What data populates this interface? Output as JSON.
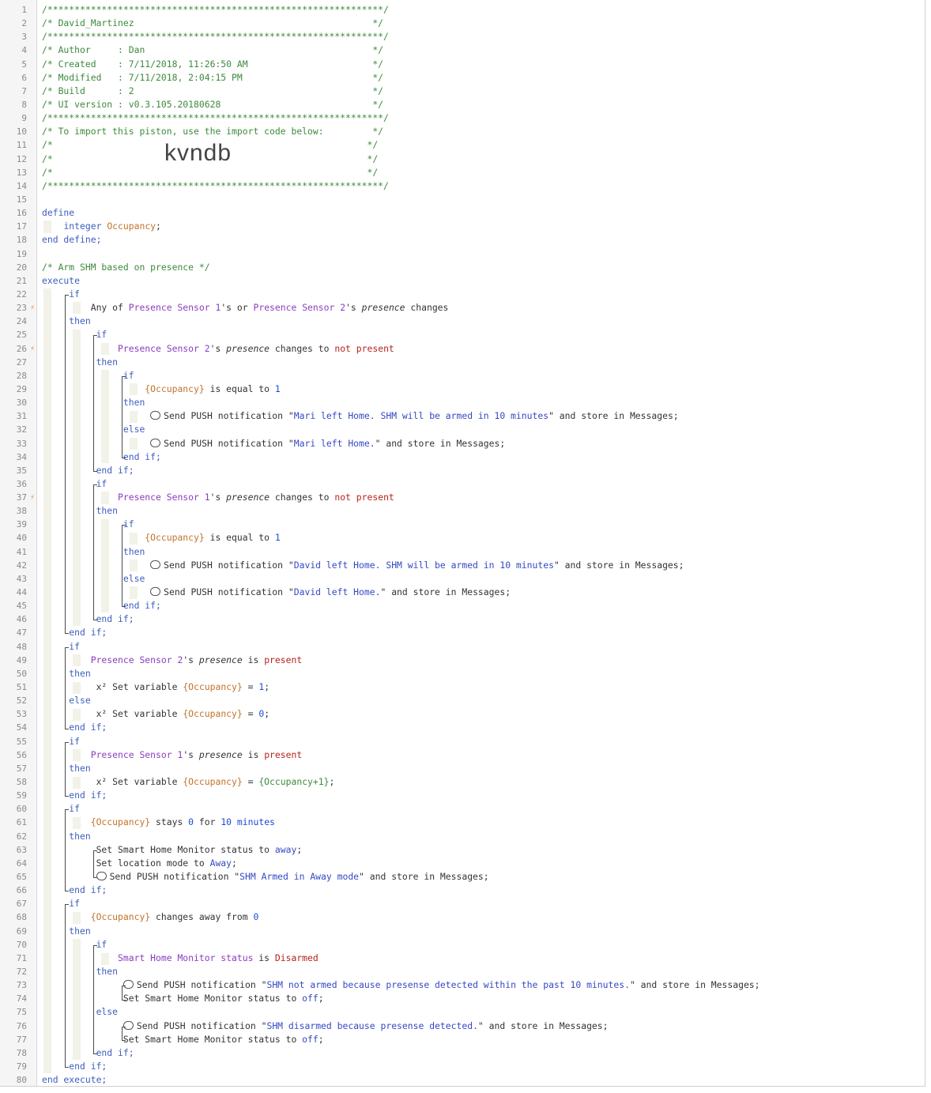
{
  "import_code": "kvndb",
  "lines": [
    {
      "n": 1,
      "t": "/**************************************************************/",
      "cls": "c-comment"
    },
    {
      "n": 2,
      "t": "/* David_Martinez                                            */",
      "cls": "c-comment"
    },
    {
      "n": 3,
      "t": "/**************************************************************/",
      "cls": "c-comment"
    },
    {
      "n": 4,
      "t": "/* Author     : Dan                                          */",
      "cls": "c-comment"
    },
    {
      "n": 5,
      "t": "/* Created    : 7/11/2018, 11:26:50 AM                       */",
      "cls": "c-comment"
    },
    {
      "n": 6,
      "t": "/* Modified   : 7/11/2018, 2:04:15 PM                        */",
      "cls": "c-comment"
    },
    {
      "n": 7,
      "t": "/* Build      : 2                                            */",
      "cls": "c-comment"
    },
    {
      "n": 8,
      "t": "/* UI version : v0.3.105.20180628                            */",
      "cls": "c-comment"
    },
    {
      "n": 9,
      "t": "/**************************************************************/",
      "cls": "c-comment"
    },
    {
      "n": 10,
      "t": "/* To import this piston, use the import code below:         */",
      "cls": "c-comment"
    },
    {
      "n": 11,
      "t": "/*                                                          */",
      "cls": "c-comment"
    },
    {
      "n": 12,
      "t": "/*                                                          */",
      "cls": "c-comment",
      "import": true
    },
    {
      "n": 13,
      "t": "/*                                                          */",
      "cls": "c-comment"
    },
    {
      "n": 14,
      "t": "/**************************************************************/",
      "cls": "c-comment"
    },
    {
      "n": 15,
      "t": "",
      "cls": "c-plain"
    },
    {
      "n": 16,
      "t": "define",
      "cls": "c-kw"
    },
    {
      "n": 17,
      "t": "",
      "segs": [
        [
          "    ",
          "c-plain"
        ],
        [
          "integer ",
          "c-kw"
        ],
        [
          "Occupancy",
          "c-var"
        ],
        [
          ";",
          "c-plain"
        ]
      ]
    },
    {
      "n": 18,
      "t": "end define;",
      "cls": "c-kw"
    },
    {
      "n": 19,
      "t": "",
      "cls": "c-plain"
    },
    {
      "n": 20,
      "t": "/* Arm SHM based on presence */",
      "cls": "c-comment"
    },
    {
      "n": 21,
      "t": "execute",
      "cls": "c-kw"
    },
    {
      "n": 22,
      "segs": [
        [
          "     if",
          "c-kw"
        ]
      ]
    },
    {
      "n": 23,
      "bolt": true,
      "segs": [
        [
          "         Any of ",
          "c-plain"
        ],
        [
          "Presence Sensor 1",
          "c-dev"
        ],
        [
          "'s or ",
          "c-plain"
        ],
        [
          "Presence Sensor 2",
          "c-dev"
        ],
        [
          "'s ",
          "c-plain"
        ],
        [
          "presence",
          "c-it"
        ],
        [
          " changes",
          "c-plain"
        ]
      ]
    },
    {
      "n": 24,
      "segs": [
        [
          "     then",
          "c-kw"
        ]
      ]
    },
    {
      "n": 25,
      "segs": [
        [
          "          if",
          "c-kw"
        ]
      ]
    },
    {
      "n": 26,
      "bolt": true,
      "segs": [
        [
          "              Presence Sensor 2",
          "c-dev"
        ],
        [
          "'s ",
          "c-plain"
        ],
        [
          "presence",
          "c-it"
        ],
        [
          " changes to ",
          "c-plain"
        ],
        [
          "not present",
          "c-red"
        ]
      ]
    },
    {
      "n": 27,
      "segs": [
        [
          "          then",
          "c-kw"
        ]
      ]
    },
    {
      "n": 28,
      "segs": [
        [
          "               if",
          "c-kw"
        ]
      ]
    },
    {
      "n": 29,
      "segs": [
        [
          "                   {Occupancy}",
          "c-var"
        ],
        [
          " is equal to ",
          "c-plain"
        ],
        [
          "1",
          "c-num"
        ]
      ]
    },
    {
      "n": 30,
      "segs": [
        [
          "               then",
          "c-kw"
        ]
      ]
    },
    {
      "n": 31,
      "bubble": true,
      "segs": [
        [
          "Send PUSH notification \"",
          "c-plain"
        ],
        [
          "Mari left Home. SHM will be armed in 10 minutes",
          "c-str"
        ],
        [
          "\" and store in Messages;",
          "c-plain"
        ]
      ],
      "indent": "                    "
    },
    {
      "n": 32,
      "segs": [
        [
          "               else",
          "c-kw"
        ]
      ]
    },
    {
      "n": 33,
      "bubble": true,
      "segs": [
        [
          "Send PUSH notification \"",
          "c-plain"
        ],
        [
          "Mari left Home.",
          "c-str"
        ],
        [
          "\" and store in Messages;",
          "c-plain"
        ]
      ],
      "indent": "                    "
    },
    {
      "n": 34,
      "segs": [
        [
          "               end if;",
          "c-kw"
        ]
      ]
    },
    {
      "n": 35,
      "segs": [
        [
          "          end if;",
          "c-kw"
        ]
      ]
    },
    {
      "n": 36,
      "segs": [
        [
          "          if",
          "c-kw"
        ]
      ]
    },
    {
      "n": 37,
      "bolt": true,
      "segs": [
        [
          "              Presence Sensor 1",
          "c-dev"
        ],
        [
          "'s ",
          "c-plain"
        ],
        [
          "presence",
          "c-it"
        ],
        [
          " changes to ",
          "c-plain"
        ],
        [
          "not present",
          "c-red"
        ]
      ]
    },
    {
      "n": 38,
      "segs": [
        [
          "          then",
          "c-kw"
        ]
      ]
    },
    {
      "n": 39,
      "segs": [
        [
          "               if",
          "c-kw"
        ]
      ]
    },
    {
      "n": 40,
      "segs": [
        [
          "                   {Occupancy}",
          "c-var"
        ],
        [
          " is equal to ",
          "c-plain"
        ],
        [
          "1",
          "c-num"
        ]
      ]
    },
    {
      "n": 41,
      "segs": [
        [
          "               then",
          "c-kw"
        ]
      ]
    },
    {
      "n": 42,
      "bubble": true,
      "segs": [
        [
          "Send PUSH notification \"",
          "c-plain"
        ],
        [
          "David left Home. SHM will be armed in 10 minutes",
          "c-str"
        ],
        [
          "\" and store in Messages;",
          "c-plain"
        ]
      ],
      "indent": "                    "
    },
    {
      "n": 43,
      "segs": [
        [
          "               else",
          "c-kw"
        ]
      ]
    },
    {
      "n": 44,
      "bubble": true,
      "segs": [
        [
          "Send PUSH notification \"",
          "c-plain"
        ],
        [
          "David left Home.",
          "c-str"
        ],
        [
          "\" and store in Messages;",
          "c-plain"
        ]
      ],
      "indent": "                    "
    },
    {
      "n": 45,
      "segs": [
        [
          "               end if;",
          "c-kw"
        ]
      ]
    },
    {
      "n": 46,
      "segs": [
        [
          "          end if;",
          "c-kw"
        ]
      ]
    },
    {
      "n": 47,
      "segs": [
        [
          "     end if;",
          "c-kw"
        ]
      ]
    },
    {
      "n": 48,
      "segs": [
        [
          "     if",
          "c-kw"
        ]
      ]
    },
    {
      "n": 49,
      "segs": [
        [
          "         Presence Sensor 2",
          "c-dev"
        ],
        [
          "'s ",
          "c-plain"
        ],
        [
          "presence",
          "c-it"
        ],
        [
          " is ",
          "c-plain"
        ],
        [
          "present",
          "c-red"
        ]
      ]
    },
    {
      "n": 50,
      "segs": [
        [
          "     then",
          "c-kw"
        ]
      ]
    },
    {
      "n": 51,
      "segs": [
        [
          "          x² Set variable ",
          "c-plain"
        ],
        [
          "{Occupancy}",
          "c-var"
        ],
        [
          " = ",
          "c-plain"
        ],
        [
          "1",
          "c-num"
        ],
        [
          ";",
          "c-plain"
        ]
      ]
    },
    {
      "n": 52,
      "segs": [
        [
          "     else",
          "c-kw"
        ]
      ]
    },
    {
      "n": 53,
      "segs": [
        [
          "          x² Set variable ",
          "c-plain"
        ],
        [
          "{Occupancy}",
          "c-var"
        ],
        [
          " = ",
          "c-plain"
        ],
        [
          "0",
          "c-num"
        ],
        [
          ";",
          "c-plain"
        ]
      ]
    },
    {
      "n": 54,
      "segs": [
        [
          "     end if;",
          "c-kw"
        ]
      ]
    },
    {
      "n": 55,
      "segs": [
        [
          "     if",
          "c-kw"
        ]
      ]
    },
    {
      "n": 56,
      "segs": [
        [
          "         Presence Sensor 1",
          "c-dev"
        ],
        [
          "'s ",
          "c-plain"
        ],
        [
          "presence",
          "c-it"
        ],
        [
          " is ",
          "c-plain"
        ],
        [
          "present",
          "c-red"
        ]
      ]
    },
    {
      "n": 57,
      "segs": [
        [
          "     then",
          "c-kw"
        ]
      ]
    },
    {
      "n": 58,
      "segs": [
        [
          "          x² Set variable ",
          "c-plain"
        ],
        [
          "{Occupancy}",
          "c-var"
        ],
        [
          " = ",
          "c-plain"
        ],
        [
          "{Occupancy+1}",
          "c-comment"
        ],
        [
          ";",
          "c-plain"
        ]
      ]
    },
    {
      "n": 59,
      "segs": [
        [
          "     end if;",
          "c-kw"
        ]
      ]
    },
    {
      "n": 60,
      "segs": [
        [
          "     if",
          "c-kw"
        ]
      ]
    },
    {
      "n": 61,
      "segs": [
        [
          "         {Occupancy}",
          "c-var"
        ],
        [
          " stays ",
          "c-plain"
        ],
        [
          "0",
          "c-num"
        ],
        [
          " for ",
          "c-plain"
        ],
        [
          "10 minutes",
          "c-num"
        ]
      ]
    },
    {
      "n": 62,
      "segs": [
        [
          "     then",
          "c-kw"
        ]
      ]
    },
    {
      "n": 63,
      "segs": [
        [
          "          Set Smart Home Monitor status to ",
          "c-plain"
        ],
        [
          "away",
          "c-str"
        ],
        [
          ";",
          "c-plain"
        ]
      ]
    },
    {
      "n": 64,
      "segs": [
        [
          "          Set location mode to ",
          "c-plain"
        ],
        [
          "Away",
          "c-str"
        ],
        [
          ";",
          "c-plain"
        ]
      ]
    },
    {
      "n": 65,
      "bubble": true,
      "segs": [
        [
          "Send PUSH notification \"",
          "c-plain"
        ],
        [
          "SHM Armed in Away mode",
          "c-str"
        ],
        [
          "\" and store in Messages;",
          "c-plain"
        ]
      ],
      "indent": "          "
    },
    {
      "n": 66,
      "segs": [
        [
          "     end if;",
          "c-kw"
        ]
      ]
    },
    {
      "n": 67,
      "segs": [
        [
          "     if",
          "c-kw"
        ]
      ]
    },
    {
      "n": 68,
      "segs": [
        [
          "         {Occupancy}",
          "c-var"
        ],
        [
          " changes away from ",
          "c-plain"
        ],
        [
          "0",
          "c-num"
        ]
      ]
    },
    {
      "n": 69,
      "segs": [
        [
          "     then",
          "c-kw"
        ]
      ]
    },
    {
      "n": 70,
      "segs": [
        [
          "          if",
          "c-kw"
        ]
      ]
    },
    {
      "n": 71,
      "segs": [
        [
          "              Smart Home Monitor status",
          "c-dev"
        ],
        [
          " is ",
          "c-plain"
        ],
        [
          "Disarmed",
          "c-red"
        ]
      ]
    },
    {
      "n": 72,
      "segs": [
        [
          "          then",
          "c-kw"
        ]
      ]
    },
    {
      "n": 73,
      "bubble": true,
      "segs": [
        [
          "Send PUSH notification \"",
          "c-plain"
        ],
        [
          "SHM not armed because presense detected within the past 10 minutes.",
          "c-str"
        ],
        [
          "\" and store in Messages;",
          "c-plain"
        ]
      ],
      "indent": "               "
    },
    {
      "n": 74,
      "segs": [
        [
          "               Set Smart Home Monitor status to ",
          "c-plain"
        ],
        [
          "off",
          "c-str"
        ],
        [
          ";",
          "c-plain"
        ]
      ]
    },
    {
      "n": 75,
      "segs": [
        [
          "          else",
          "c-kw"
        ]
      ]
    },
    {
      "n": 76,
      "bubble": true,
      "segs": [
        [
          "Send PUSH notification \"",
          "c-plain"
        ],
        [
          "SHM disarmed because presense detected.",
          "c-str"
        ],
        [
          "\" and store in Messages;",
          "c-plain"
        ]
      ],
      "indent": "               "
    },
    {
      "n": 77,
      "segs": [
        [
          "               Set Smart Home Monitor status to ",
          "c-plain"
        ],
        [
          "off",
          "c-str"
        ],
        [
          ";",
          "c-plain"
        ]
      ]
    },
    {
      "n": 78,
      "segs": [
        [
          "          end if;",
          "c-kw"
        ]
      ]
    },
    {
      "n": 79,
      "segs": [
        [
          "     end if;",
          "c-kw"
        ]
      ]
    },
    {
      "n": 80,
      "t": "end execute;",
      "cls": "c-kw"
    }
  ]
}
